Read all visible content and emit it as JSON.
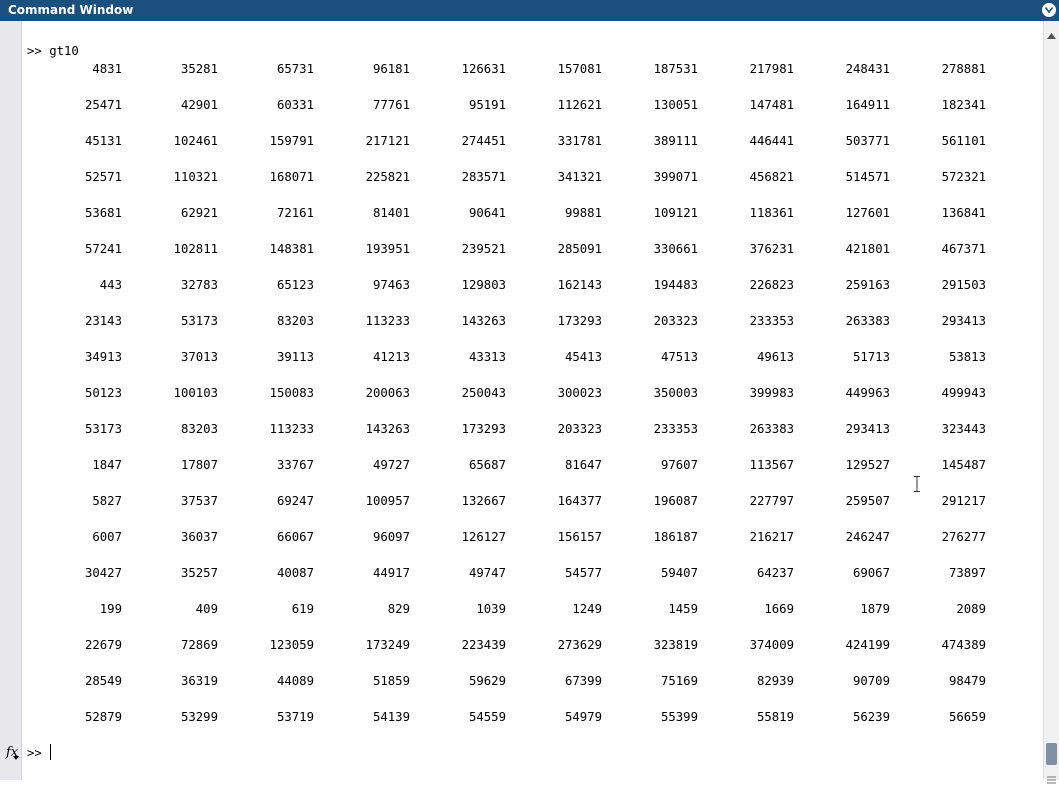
{
  "window": {
    "title": "Command Window"
  },
  "command": {
    "prompt": ">>",
    "text": "gt10"
  },
  "matrix": {
    "rows": [
      [
        "4831",
        "35281",
        "65731",
        "96181",
        "126631",
        "157081",
        "187531",
        "217981",
        "248431",
        "278881"
      ],
      [
        "25471",
        "42901",
        "60331",
        "77761",
        "95191",
        "112621",
        "130051",
        "147481",
        "164911",
        "182341"
      ],
      [
        "45131",
        "102461",
        "159791",
        "217121",
        "274451",
        "331781",
        "389111",
        "446441",
        "503771",
        "561101"
      ],
      [
        "52571",
        "110321",
        "168071",
        "225821",
        "283571",
        "341321",
        "399071",
        "456821",
        "514571",
        "572321"
      ],
      [
        "53681",
        "62921",
        "72161",
        "81401",
        "90641",
        "99881",
        "109121",
        "118361",
        "127601",
        "136841"
      ],
      [
        "57241",
        "102811",
        "148381",
        "193951",
        "239521",
        "285091",
        "330661",
        "376231",
        "421801",
        "467371"
      ],
      [
        "443",
        "32783",
        "65123",
        "97463",
        "129803",
        "162143",
        "194483",
        "226823",
        "259163",
        "291503"
      ],
      [
        "23143",
        "53173",
        "83203",
        "113233",
        "143263",
        "173293",
        "203323",
        "233353",
        "263383",
        "293413"
      ],
      [
        "34913",
        "37013",
        "39113",
        "41213",
        "43313",
        "45413",
        "47513",
        "49613",
        "51713",
        "53813"
      ],
      [
        "50123",
        "100103",
        "150083",
        "200063",
        "250043",
        "300023",
        "350003",
        "399983",
        "449963",
        "499943"
      ],
      [
        "53173",
        "83203",
        "113233",
        "143263",
        "173293",
        "203323",
        "233353",
        "263383",
        "293413",
        "323443"
      ],
      [
        "1847",
        "17807",
        "33767",
        "49727",
        "65687",
        "81647",
        "97607",
        "113567",
        "129527",
        "145487"
      ],
      [
        "5827",
        "37537",
        "69247",
        "100957",
        "132667",
        "164377",
        "196087",
        "227797",
        "259507",
        "291217"
      ],
      [
        "6007",
        "36037",
        "66067",
        "96097",
        "126127",
        "156157",
        "186187",
        "216217",
        "246247",
        "276277"
      ],
      [
        "30427",
        "35257",
        "40087",
        "44917",
        "49747",
        "54577",
        "59407",
        "64237",
        "69067",
        "73897"
      ],
      [
        "199",
        "409",
        "619",
        "829",
        "1039",
        "1249",
        "1459",
        "1669",
        "1879",
        "2089"
      ],
      [
        "22679",
        "72869",
        "123059",
        "173249",
        "223439",
        "273629",
        "323819",
        "374009",
        "424199",
        "474389"
      ],
      [
        "28549",
        "36319",
        "44089",
        "51859",
        "59629",
        "67399",
        "75169",
        "82939",
        "90709",
        "98479"
      ],
      [
        "52879",
        "53299",
        "53719",
        "54139",
        "54559",
        "54979",
        "55399",
        "55819",
        "56239",
        "56659"
      ]
    ]
  },
  "prompt_line": {
    "fx": "fx",
    "prompt": ">>"
  },
  "icons": {
    "menu": "chevron-down-circle-icon",
    "fx": "function-icon",
    "scroll_up": "arrow-up-icon",
    "scroll_down": "grip-icon"
  },
  "colors": {
    "title_bar": "#1a4f7e",
    "left_gutter": "#e8e8ec",
    "scroll_thumb": "#7f8fa6"
  }
}
